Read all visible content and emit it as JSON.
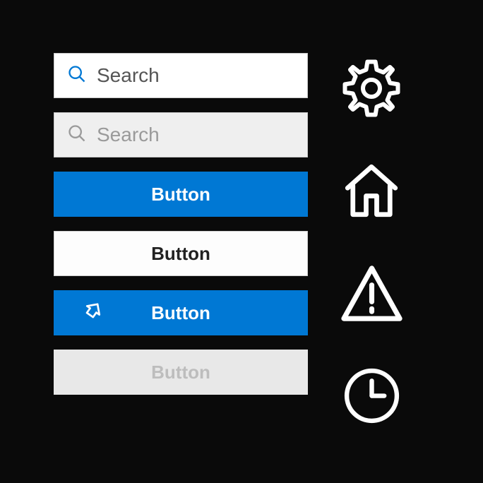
{
  "search": {
    "active_placeholder": "Search",
    "disabled_placeholder": "Search"
  },
  "buttons": {
    "primary_label": "Button",
    "secondary_label": "Button",
    "icon_primary_label": "Button",
    "disabled_label": "Button"
  },
  "icons": {
    "settings": "gear-icon",
    "home": "home-icon",
    "alert": "warning-icon",
    "history": "clock-icon"
  },
  "colors": {
    "primary": "#0078d4",
    "background": "#0a0a0a"
  }
}
